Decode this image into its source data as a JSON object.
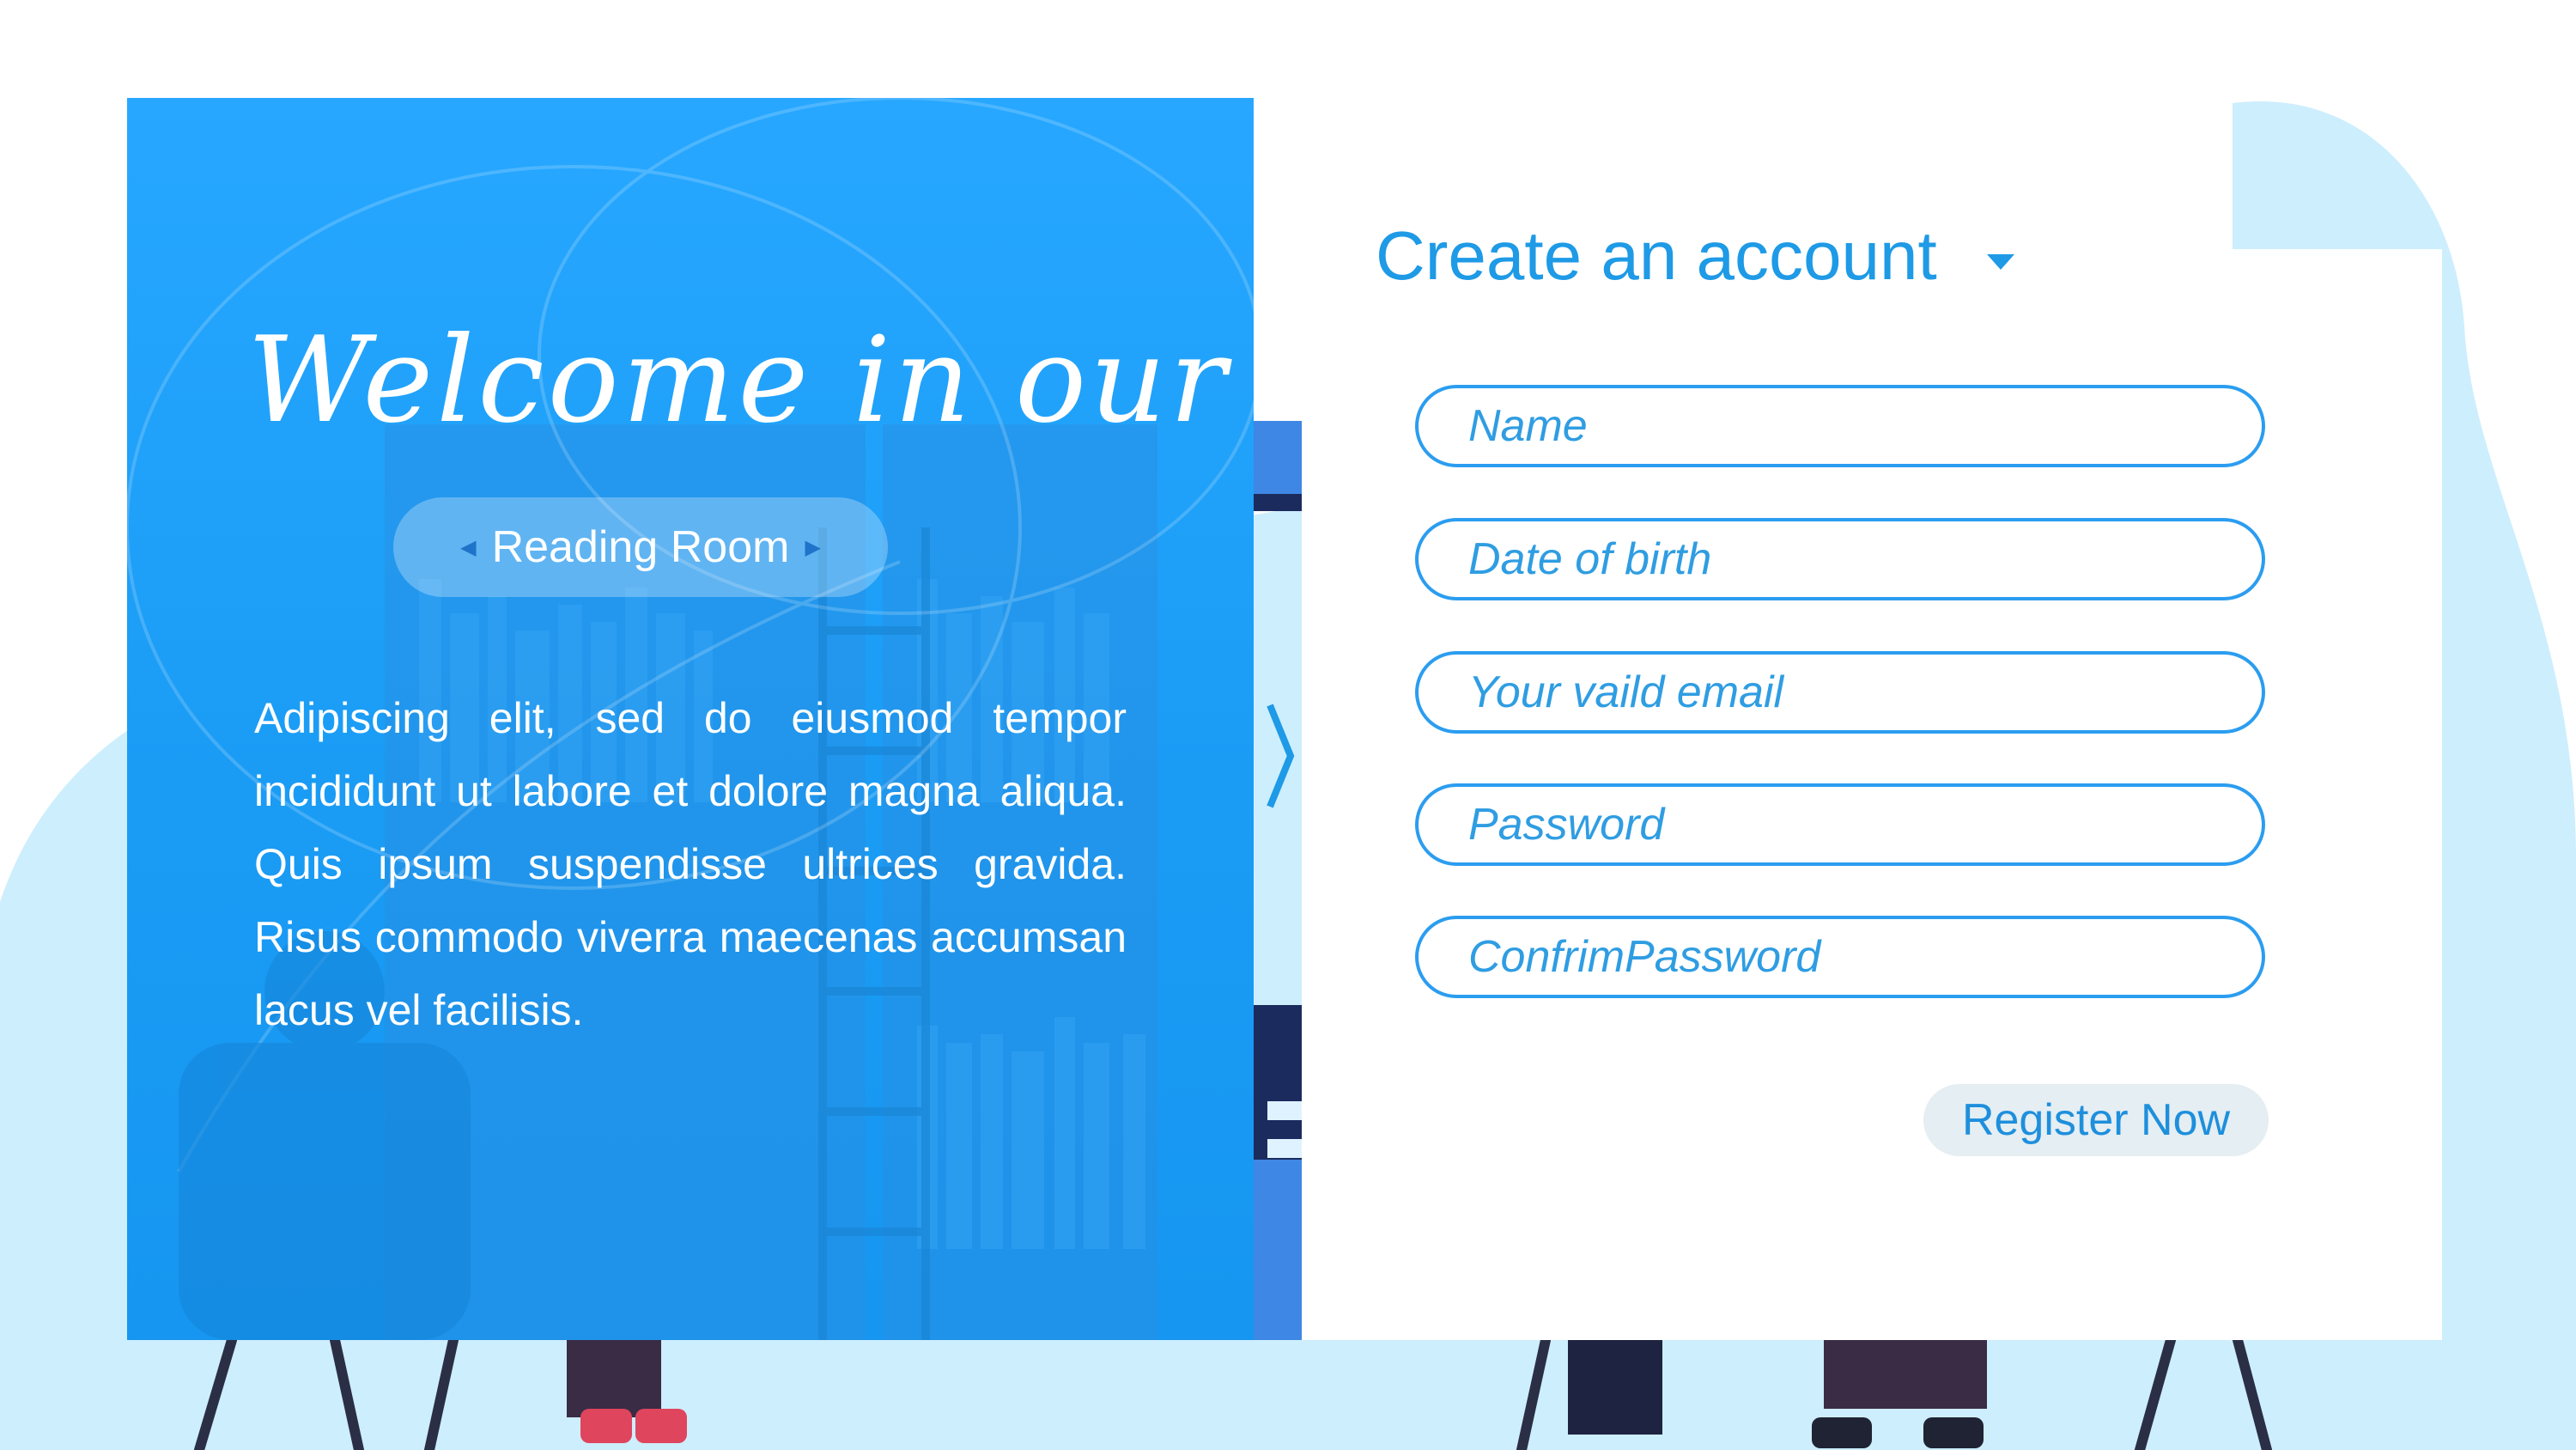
{
  "welcome": {
    "title": "Welcome in our",
    "room_label": "Reading Room",
    "description": "Adipiscing elit, sed do eiusmod tempor incididunt ut labore et dolore magna aliqua. Quis ipsum suspendisse ultrices gravida. Risus commodo viverra maecenas accumsan lacus vel facilisis."
  },
  "form": {
    "heading": "Create an account",
    "fields": {
      "name_placeholder": "Name",
      "dob_placeholder": "Date of birth",
      "email_placeholder": "Your vaild email",
      "password_placeholder": "Password",
      "confirm_placeholder": "ConfrimPassword"
    },
    "register_label": "Register Now"
  },
  "icons": {
    "next": "chevron-right-icon",
    "dropdown": "caret-down-icon",
    "pill_arrows": "triangle-left-right-icon"
  },
  "colors": {
    "accent": "#1e9ae6",
    "panel_blue": "#1a9cf5",
    "blob": "#cdeefd",
    "button_bg": "#e4eef3"
  }
}
